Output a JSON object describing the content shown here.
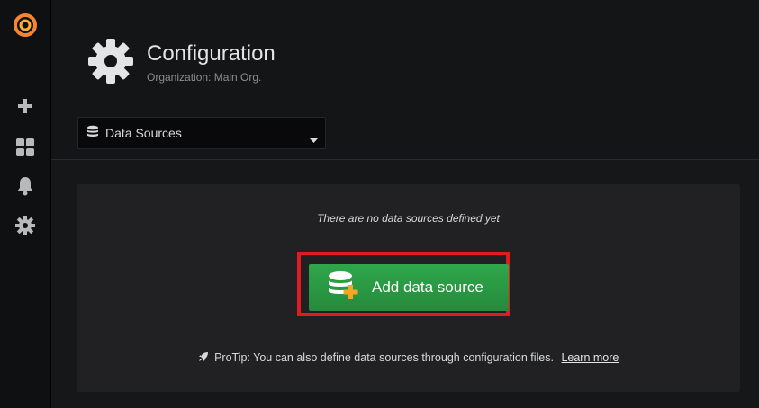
{
  "header": {
    "title": "Configuration",
    "subtitle": "Organization: Main Org."
  },
  "nav": {
    "selected": "Data Sources"
  },
  "empty_state": {
    "message": "There are no data sources defined yet",
    "button_label": "Add data source",
    "protip_text": "ProTip: You can also define data sources through configuration files.",
    "learn_more": "Learn more"
  },
  "sidebar": {
    "items": [
      {
        "icon": "grafana-logo-icon"
      },
      {
        "icon": "plus-icon"
      },
      {
        "icon": "dashboards-grid-icon"
      },
      {
        "icon": "bell-icon"
      },
      {
        "icon": "gear-icon"
      }
    ]
  },
  "colors": {
    "accent_green": "#2fa74a",
    "highlight_red": "#e21b23",
    "logo_orange": "#f6852f"
  }
}
